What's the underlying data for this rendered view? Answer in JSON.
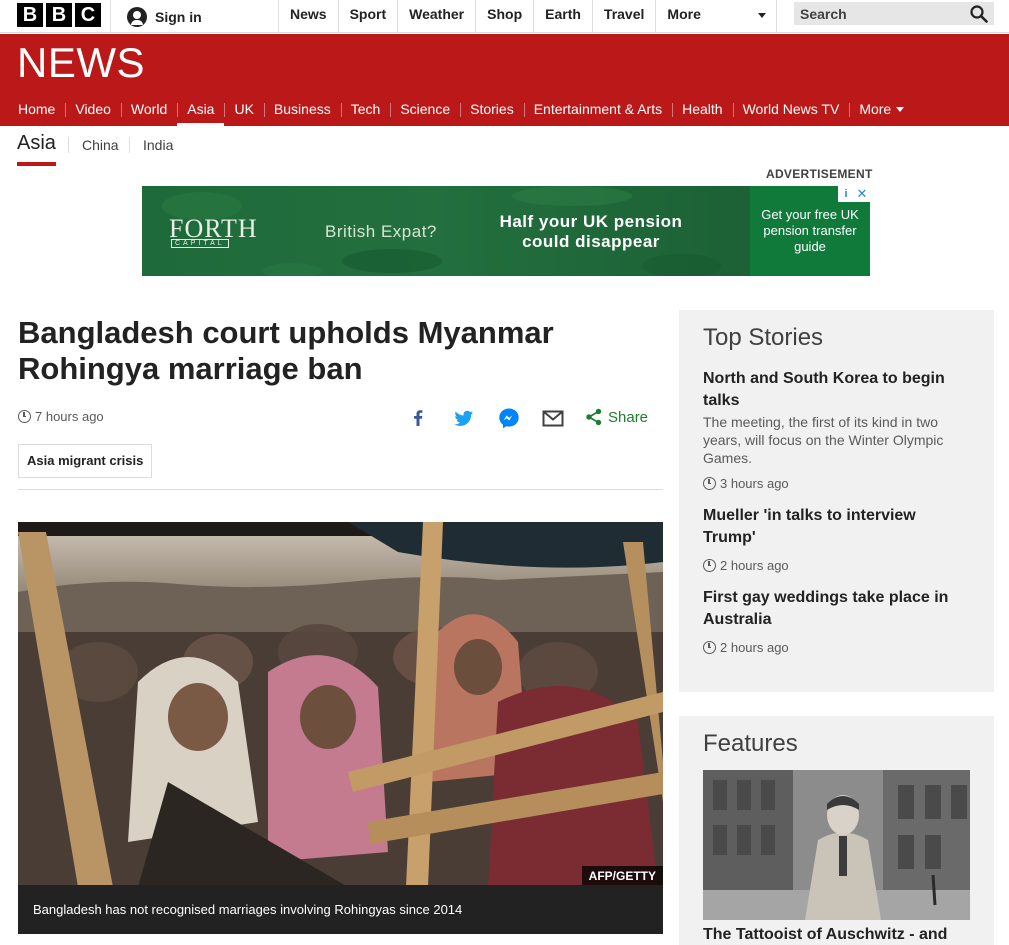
{
  "topbar": {
    "bbc_letters": [
      "B",
      "B",
      "C"
    ],
    "sign_in": "Sign in",
    "nav": [
      "News",
      "Sport",
      "Weather",
      "Shop",
      "Earth",
      "Travel"
    ],
    "more": "More",
    "search_placeholder": "Search"
  },
  "masthead": {
    "title": "NEWS",
    "nav": [
      "Home",
      "Video",
      "World",
      "Asia",
      "UK",
      "Business",
      "Tech",
      "Science",
      "Stories",
      "Entertainment & Arts",
      "Health",
      "World News TV"
    ],
    "active": "Asia",
    "more": "More"
  },
  "subnav": {
    "current": "Asia",
    "items": [
      "China",
      "India"
    ]
  },
  "ad": {
    "label": "ADVERTISEMENT",
    "logo": "FORTH",
    "logo_sub": "CAPITAL",
    "expat": "British Expat?",
    "headline": "Half your UK pension could disappear",
    "cta": "Get your free UK pension transfer guide",
    "choice_i": "i",
    "choice_x": "✕",
    "colors": {
      "bg": "#1e6a3a",
      "cta_bg": "#0f7a3a"
    }
  },
  "article": {
    "headline": "Bangladesh court upholds Myanmar Rohingya marriage ban",
    "time": "7 hours ago",
    "share_label": "Share",
    "share_icons": [
      "facebook-icon",
      "twitter-icon",
      "messenger-icon",
      "email-icon",
      "share-icon"
    ],
    "tag": "Asia migrant crisis",
    "image_credit": "AFP/GETTY",
    "image_caption": "Bangladesh has not recognised marriages involving Rohingyas since 2014"
  },
  "top_stories": {
    "title": "Top Stories",
    "items": [
      {
        "title": "North and South Korea to begin talks",
        "summary": "The meeting, the first of its kind in two years, will focus on the Winter Olympic Games.",
        "time": "3 hours ago"
      },
      {
        "title": "Mueller 'in talks to interview Trump'",
        "summary": "",
        "time": "2 hours ago"
      },
      {
        "title": "First gay weddings take place in Australia",
        "summary": "",
        "time": "2 hours ago"
      }
    ]
  },
  "features": {
    "title": "Features",
    "first_title": "The Tattooist of Auschwitz - and"
  },
  "colors": {
    "brand_red": "#bb1919",
    "share_green": "#1c7d2c",
    "facebook_blue": "#3b5998",
    "twitter_blue": "#1da1f2",
    "messenger_blue": "#0084ff"
  }
}
